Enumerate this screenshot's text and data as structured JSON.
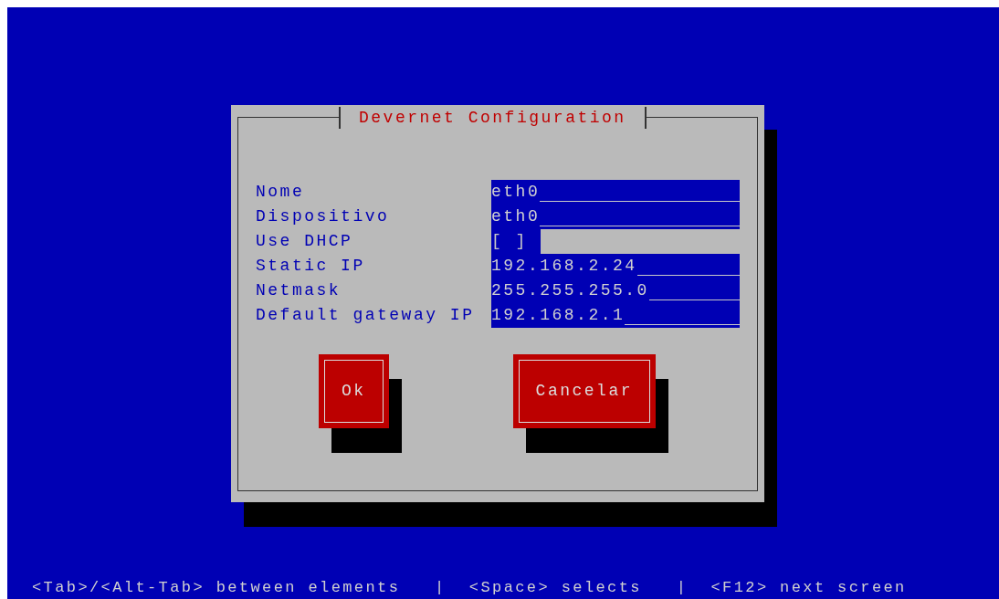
{
  "dialog": {
    "title": "Devernet Configuration",
    "fields": [
      {
        "kind": "entry",
        "label": "Nome",
        "value": "eth0"
      },
      {
        "kind": "entry",
        "label": "Dispositivo",
        "value": "eth0"
      },
      {
        "kind": "checkbox",
        "label": "Use DHCP",
        "value": "[ ]",
        "checked": false
      },
      {
        "kind": "entry",
        "label": "Static IP",
        "value": "192.168.2.24"
      },
      {
        "kind": "entry",
        "label": "Netmask",
        "value": "255.255.255.0"
      },
      {
        "kind": "entry",
        "label": "Default gateway IP",
        "value": "192.168.2.1"
      }
    ],
    "buttons": [
      "Ok",
      "Cancelar"
    ]
  },
  "help_line": "<Tab>/<Alt-Tab> between elements   |  <Space> selects   |  <F12> next screen"
}
